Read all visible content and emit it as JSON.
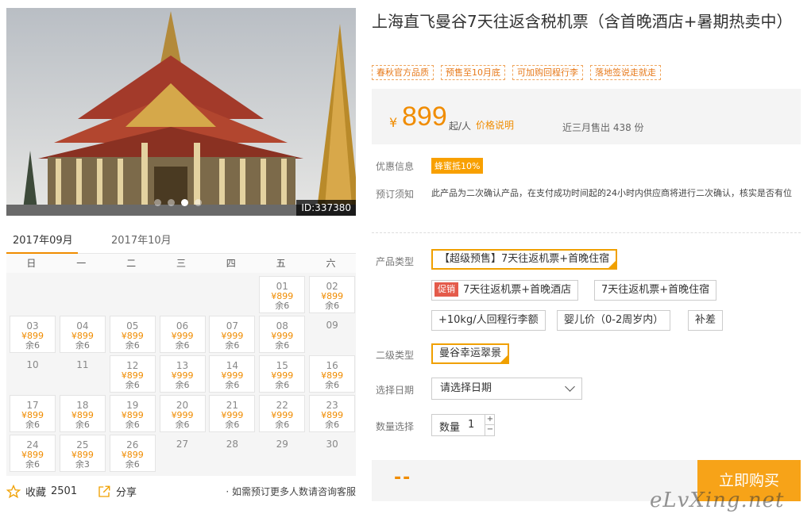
{
  "photo": {
    "id_label": "ID:337380",
    "slides": 4,
    "active_slide": 2
  },
  "calendar": {
    "tabs": [
      "2017年09月",
      "2017年10月"
    ],
    "weekdays": [
      "日",
      "一",
      "二",
      "三",
      "四",
      "五",
      "六"
    ],
    "days": [
      {
        "d": "01",
        "p": "¥899",
        "r": "余6"
      },
      {
        "d": "02",
        "p": "¥899",
        "r": "余6"
      },
      {
        "d": "03",
        "p": "¥899",
        "r": "余6"
      },
      {
        "d": "04",
        "p": "¥899",
        "r": "余6"
      },
      {
        "d": "05",
        "p": "¥899",
        "r": "余6"
      },
      {
        "d": "06",
        "p": "¥999",
        "r": "余6"
      },
      {
        "d": "07",
        "p": "¥999",
        "r": "余6"
      },
      {
        "d": "08",
        "p": "¥999",
        "r": "余6"
      },
      {
        "d": "09"
      },
      {
        "d": "10"
      },
      {
        "d": "11"
      },
      {
        "d": "12",
        "p": "¥899",
        "r": "余6"
      },
      {
        "d": "13",
        "p": "¥999",
        "r": "余6"
      },
      {
        "d": "14",
        "p": "¥999",
        "r": "余6"
      },
      {
        "d": "15",
        "p": "¥999",
        "r": "余6"
      },
      {
        "d": "16",
        "p": "¥899",
        "r": "余6"
      },
      {
        "d": "17",
        "p": "¥899",
        "r": "余6"
      },
      {
        "d": "18",
        "p": "¥899",
        "r": "余6"
      },
      {
        "d": "19",
        "p": "¥899",
        "r": "余6"
      },
      {
        "d": "20",
        "p": "¥999",
        "r": "余6"
      },
      {
        "d": "21",
        "p": "¥999",
        "r": "余6"
      },
      {
        "d": "22",
        "p": "¥999",
        "r": "余6"
      },
      {
        "d": "23",
        "p": "¥899",
        "r": "余6"
      },
      {
        "d": "24",
        "p": "¥899",
        "r": "余6"
      },
      {
        "d": "25",
        "p": "¥899",
        "r": "余3"
      },
      {
        "d": "26",
        "p": "¥899",
        "r": "余6"
      },
      {
        "d": "27"
      },
      {
        "d": "28"
      },
      {
        "d": "29"
      },
      {
        "d": "30"
      }
    ]
  },
  "actions": {
    "fav_label": "收藏",
    "fav_count": "2501",
    "share_label": "分享",
    "contact": "· 如需预订更多人数请咨询客服"
  },
  "product": {
    "title": "上海直飞曼谷7天往返含税机票（含首晚酒店+暑期热卖中）",
    "tags": [
      "春秋官方品质",
      "预售至10月底",
      "可加购回程行李",
      "落地签说走就走"
    ],
    "currency": "¥",
    "price": "899",
    "per": "起/人",
    "price_note": "价格说明",
    "sold": "近三月售出 438 份"
  },
  "info": {
    "promo_label": "优惠信息",
    "promo_badge": "蜂蜜抵10%",
    "notice_label": "预订须知",
    "notice_text": "此产品为二次确认产品，在支付成功时间起的24小时内供应商将进行二次确认，核实是否有位"
  },
  "options": {
    "type_label": "产品类型",
    "types": [
      "【超级预售】7天往返机票+首晚住宿",
      "7天往返机票+首晚酒店",
      "7天往返机票+首晚住宿",
      "+10kg/人回程行李额",
      "婴儿价（0-2周岁内）",
      "补差"
    ],
    "hot_badge": "促销",
    "sub_label": "二级类型",
    "sub_value": "曼谷幸运翠景",
    "date_label": "选择日期",
    "date_placeholder": "请选择日期",
    "qty_label_row": "数量选择",
    "qty_label": "数量",
    "qty_value": "1",
    "plus": "+",
    "minus": "−"
  },
  "buy": {
    "total": "--",
    "button": "立即购买"
  },
  "watermark": "eLvXing.net"
}
